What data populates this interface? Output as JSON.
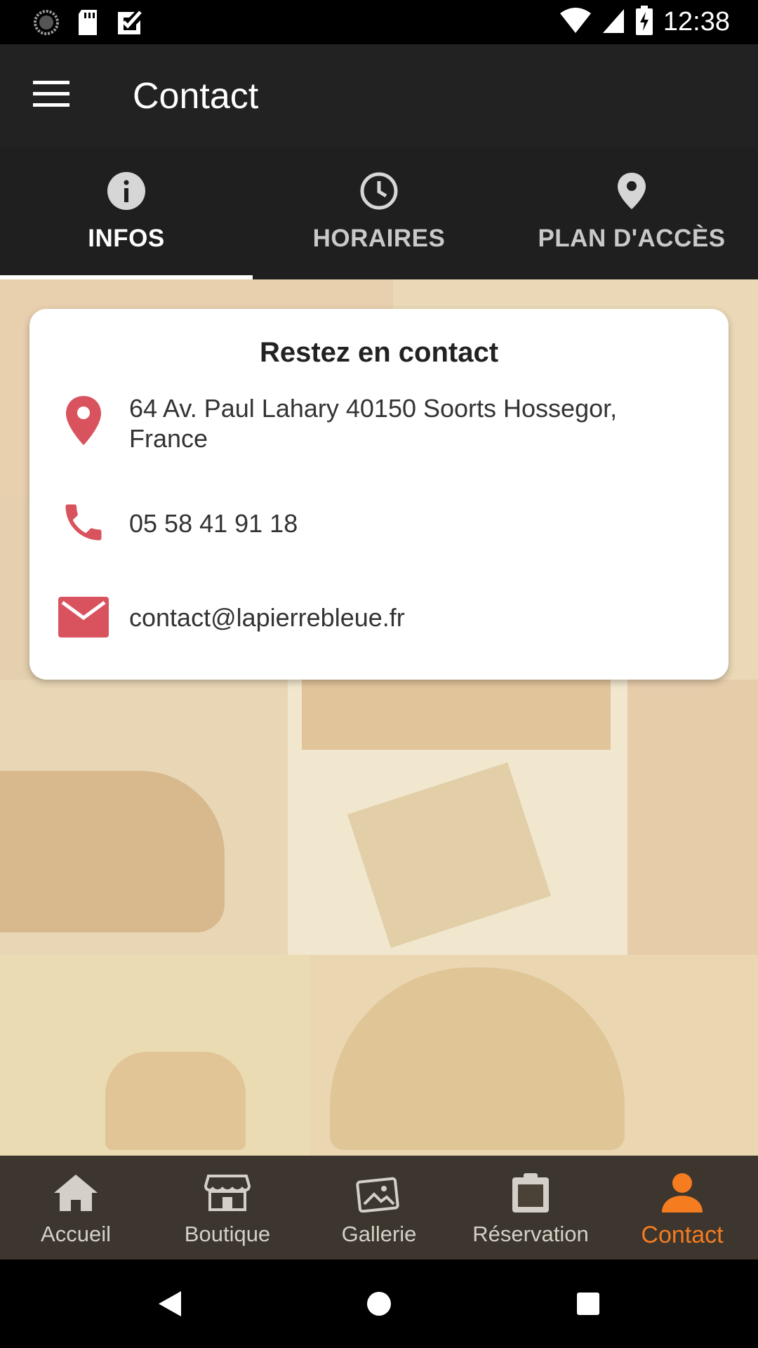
{
  "status_bar": {
    "time": "12:38",
    "left_icons": [
      "sync-icon",
      "sd-card-icon",
      "check-box-icon"
    ],
    "right_icons": [
      "wifi-icon",
      "signal-icon",
      "battery-charging-icon"
    ]
  },
  "app_bar": {
    "title": "Contact",
    "menu_icon": "hamburger-menu-icon"
  },
  "tabs": [
    {
      "label": "INFOS",
      "icon": "info-icon",
      "active": true
    },
    {
      "label": "HORAIRES",
      "icon": "clock-icon",
      "active": false
    },
    {
      "label": "PLAN D'ACCÈS",
      "icon": "location-pin-icon",
      "active": false
    }
  ],
  "card": {
    "title": "Restez en contact",
    "address": "64 Av. Paul Lahary 40150 Soorts Hossegor, France",
    "phone": "05 58 41 91 18",
    "email": "contact@lapierrebleue.fr",
    "accent_color": "#d9535f"
  },
  "bottom_nav": [
    {
      "label": "Accueil",
      "icon": "home-icon",
      "active": false
    },
    {
      "label": "Boutique",
      "icon": "store-icon",
      "active": false
    },
    {
      "label": "Gallerie",
      "icon": "gallery-icon",
      "active": false
    },
    {
      "label": "Réservation",
      "icon": "clipboard-icon",
      "active": false
    },
    {
      "label": "Contact",
      "icon": "person-icon",
      "active": true
    }
  ],
  "colors": {
    "active_nav": "#f57c1f",
    "app_bar": "#222222",
    "tab_bar": "#1f1f1f"
  },
  "system_nav": [
    "back-icon",
    "home-circle-icon",
    "recents-icon"
  ]
}
